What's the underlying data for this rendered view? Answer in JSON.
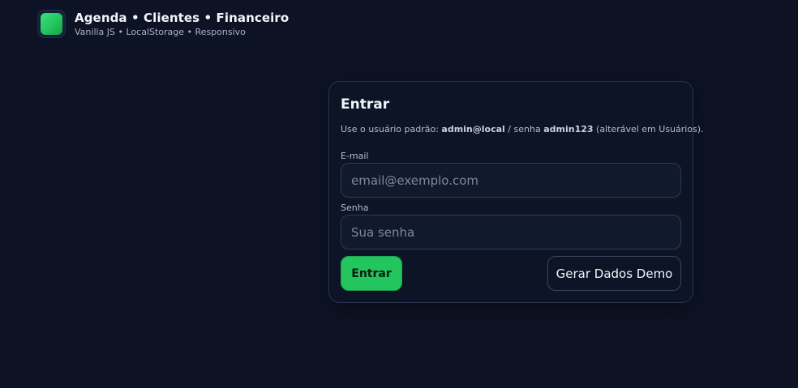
{
  "header": {
    "title": "Agenda • Clientes • Financeiro",
    "subtitle": "Vanilla JS • LocalStorage • Responsivo",
    "logo_icon": "app-logo-icon"
  },
  "login": {
    "title": "Entrar",
    "hint": {
      "prefix": "Use o usuário padrão: ",
      "user": "admin@local",
      "middle": " / senha ",
      "password": "admin123",
      "suffix": " (alterável em Usuários)."
    },
    "email_label": "E-mail",
    "email_placeholder": "email@exemplo.com",
    "email_value": "",
    "password_label": "Senha",
    "password_placeholder": "Sua senha",
    "password_value": "",
    "submit_label": "Entrar",
    "demo_label": "Gerar Dados Demo"
  },
  "colors": {
    "background": "#0d1324",
    "accent": "#22c55e",
    "card_border": "#2a3650"
  }
}
